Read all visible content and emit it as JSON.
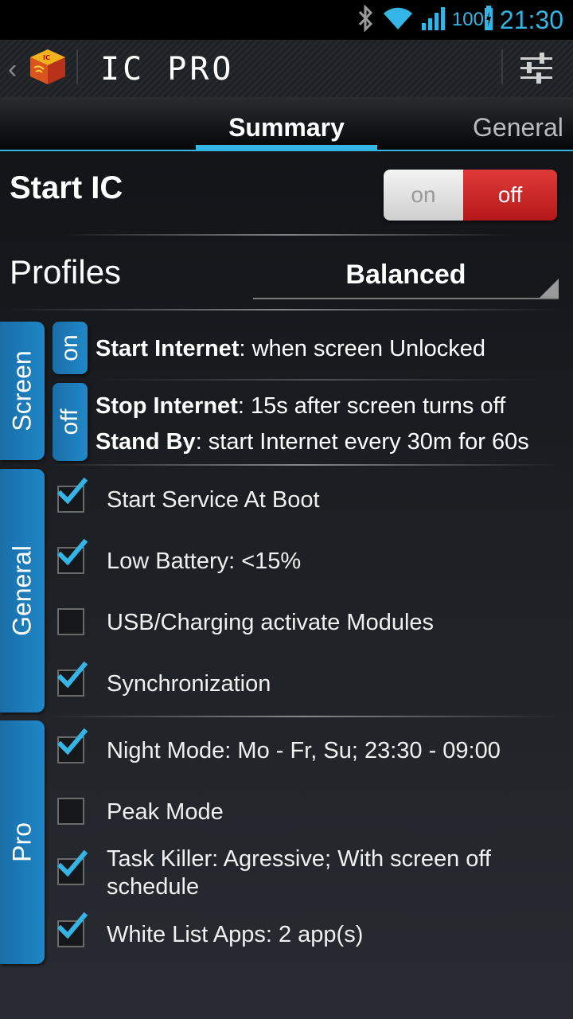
{
  "status_bar": {
    "battery": "100",
    "time": "21:30"
  },
  "action_bar": {
    "title": "IC PRO"
  },
  "tabs": [
    {
      "label": "Summary"
    },
    {
      "label": "General"
    }
  ],
  "start": {
    "title": "Start IC",
    "toggle_on": "on",
    "toggle_off": "off",
    "state": "off"
  },
  "profiles": {
    "label": "Profiles",
    "selected": "Balanced"
  },
  "screen": {
    "label": "Screen",
    "on": {
      "tag": "on",
      "bold": "Start Internet",
      "text": ": when screen Unlocked"
    },
    "off": {
      "tag": "off",
      "line1_bold": "Stop Internet",
      "line1_text": ": 15s after screen turns off",
      "line2_bold": "Stand By",
      "line2_text": ": start Internet every 30m for 60s"
    }
  },
  "general": {
    "label": "General",
    "items": [
      {
        "label": "Start Service At Boot",
        "checked": true
      },
      {
        "label": "Low Battery: <15%",
        "checked": true
      },
      {
        "label": "USB/Charging activate Modules",
        "checked": false
      },
      {
        "label": "Synchronization",
        "checked": true
      }
    ]
  },
  "pro": {
    "label": "Pro",
    "items": [
      {
        "label": "Night Mode: Mo - Fr, Su; 23:30 - 09:00",
        "checked": true
      },
      {
        "label": "Peak Mode",
        "checked": false
      },
      {
        "label": "Task Killer: Agressive; With screen off schedule",
        "checked": true
      },
      {
        "label": "White List Apps: 2 app(s)",
        "checked": true
      }
    ]
  },
  "colors": {
    "accent": "#33b5e5",
    "toggle_off": "#c82020",
    "side_tab": "#1f7fc0"
  }
}
